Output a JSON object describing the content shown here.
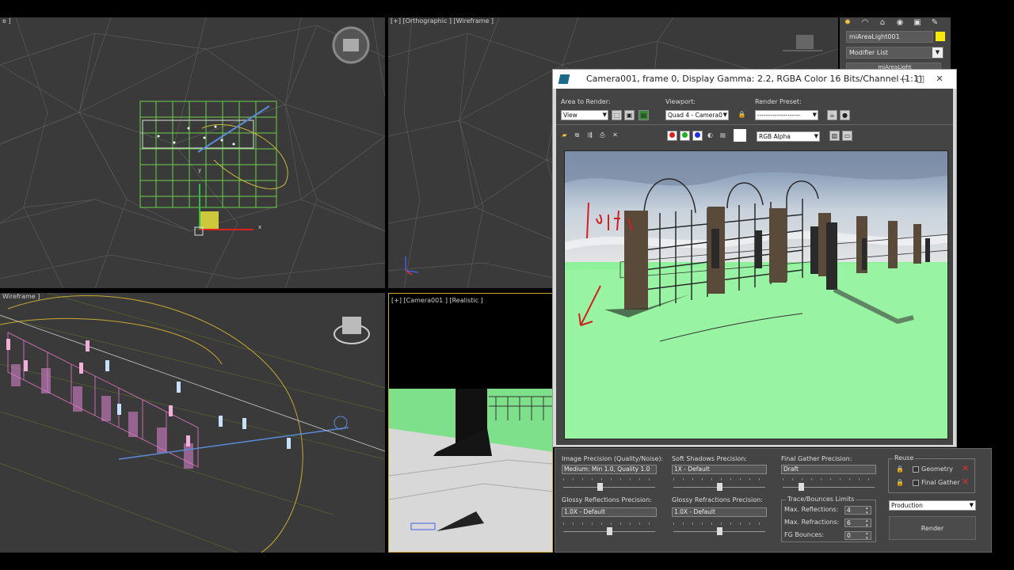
{
  "viewports": {
    "top_left": {
      "label": "e ]"
    },
    "top_right": {
      "label": "[+] [Orthographic ] [Wireframe ]"
    },
    "bottom_left": {
      "label": "Wireframe ]"
    },
    "bottom_right": {
      "label": "[+] [Camera001 ] [Realistic ]"
    },
    "axis_x": "x",
    "axis_y": "y"
  },
  "command_panel": {
    "object_name": "miAreaLight001",
    "modifier_list": "Modifier List",
    "stack_item": "miAreaLight",
    "object_color": "#f5e90a",
    "tabs": [
      "create-icon",
      "modify-icon",
      "hierarchy-icon",
      "motion-icon",
      "display-icon",
      "utilities-icon"
    ]
  },
  "render_window": {
    "title": "Camera001, frame 0, Display Gamma: 2.2, RGBA Color 16 Bits/Channel (1:1)",
    "area_to_render_label": "Area to Render:",
    "area_to_render_value": "View",
    "viewport_label": "Viewport:",
    "viewport_value": "Quad 4 - Camera0",
    "render_preset_label": "Render Preset:",
    "render_preset_value": "--------------------",
    "channel_value": "RGB Alpha",
    "annotation_text": "light",
    "channel_colors": [
      "#e02020",
      "#20b020",
      "#2030e0"
    ]
  },
  "render_settings": {
    "image_precision_label": "Image Precision (Quality/Noise):",
    "image_precision_value": "Medium: Min 1.0, Quality 1.0",
    "soft_shadows_label": "Soft Shadows Precision:",
    "soft_shadows_value": "1X - Default",
    "final_gather_label": "Final Gather Precision:",
    "final_gather_value": "Draft",
    "glossy_reflections_label": "Glossy Reflections Precision:",
    "glossy_reflections_value": "1.0X - Default",
    "glossy_refractions_label": "Glossy Refractions Precision:",
    "glossy_refractions_value": "1.0X - Default",
    "trace_limits_label": "Trace/Bounces Limits",
    "max_reflections_label": "Max. Reflections:",
    "max_reflections_value": "4",
    "max_refractions_label": "Max. Refractions:",
    "max_refractions_value": "6",
    "fg_bounces_label": "FG Bounces:",
    "fg_bounces_value": "0",
    "reuse_label": "Reuse",
    "geometry_label": "Geometry",
    "final_gather_reuse_label": "Final Gather",
    "preset_value": "Production",
    "render_button": "Render",
    "sliders": {
      "image_precision": 0.4,
      "soft_shadows": 0.5,
      "final_gather": 0.2,
      "glossy_reflections": 0.5,
      "glossy_refractions": 0.5
    }
  }
}
